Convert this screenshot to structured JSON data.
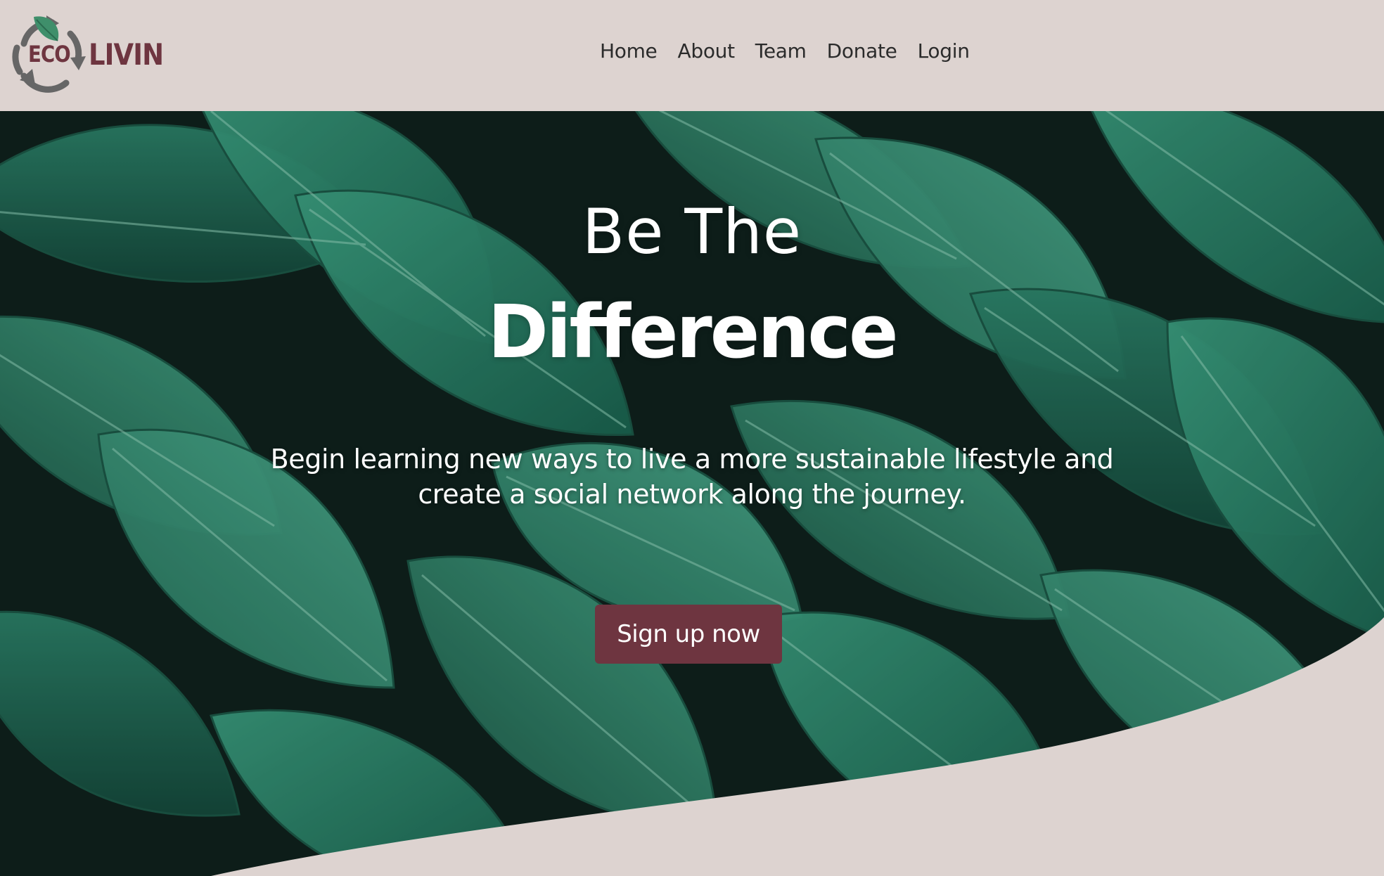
{
  "header": {
    "logo": {
      "text_left": "ECO",
      "text_right": "LIVIN",
      "icon": "recycle-leaf-icon",
      "color": "#6e3540"
    },
    "nav": [
      {
        "label": "Home"
      },
      {
        "label": "About"
      },
      {
        "label": "Team"
      },
      {
        "label": "Donate"
      },
      {
        "label": "Login"
      }
    ]
  },
  "hero": {
    "title_line1": "Be The",
    "title_line2": "Difference",
    "subtitle": "Begin learning new ways to live a more sustainable lifestyle and create a social network along the journey.",
    "cta_label": "Sign up now",
    "background": "tropical-leaves-photo"
  },
  "colors": {
    "header_bg": "#ddd3d0",
    "accent": "#6e3540",
    "leaf": "#2f8f72",
    "nav_text": "#2b2b2b"
  }
}
